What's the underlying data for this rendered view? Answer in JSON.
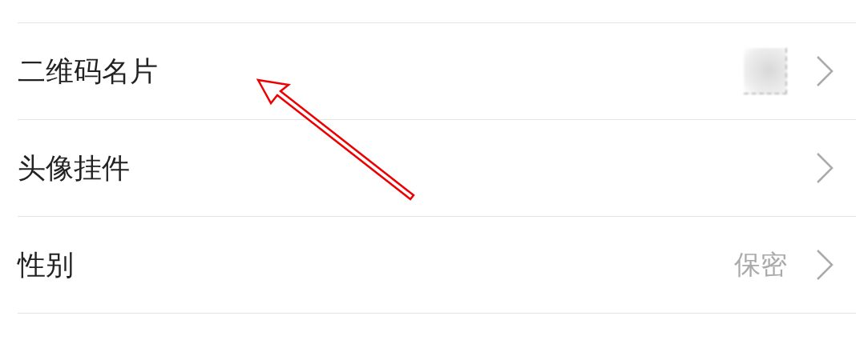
{
  "rows": [
    {
      "label": "二维码名片",
      "thumbnail": true
    },
    {
      "label": "头像挂件",
      "thumbnail": false
    },
    {
      "label": "性别",
      "thumbnail": false,
      "value": "保密"
    }
  ]
}
